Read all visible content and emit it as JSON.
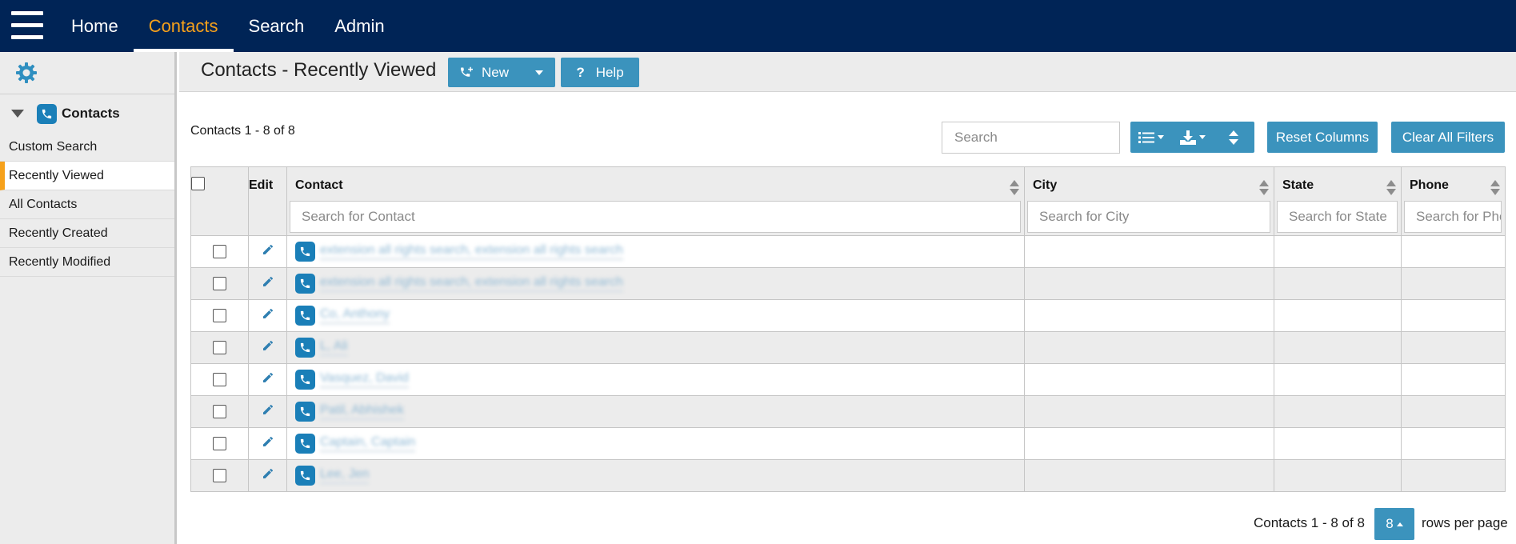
{
  "topnav": {
    "items": [
      {
        "label": "Home",
        "active": false
      },
      {
        "label": "Contacts",
        "active": true
      },
      {
        "label": "Search",
        "active": false
      },
      {
        "label": "Admin",
        "active": false
      }
    ]
  },
  "sidebar": {
    "heading": "Contacts",
    "items": [
      {
        "label": "Custom Search",
        "active": false
      },
      {
        "label": "Recently Viewed",
        "active": true
      },
      {
        "label": "All Contacts",
        "active": false
      },
      {
        "label": "Recently Created",
        "active": false
      },
      {
        "label": "Recently Modified",
        "active": false
      }
    ]
  },
  "page": {
    "title": "Contacts - Recently Viewed",
    "new_label": "New",
    "help_label": "Help",
    "count_top": "Contacts 1 - 8 of 8",
    "search_placeholder": "Search",
    "reset_label": "Reset Columns",
    "clear_label": "Clear All Filters",
    "count_bottom": "Contacts 1 - 8 of 8",
    "rows_per_page_value": "8",
    "rows_per_page_label": "rows per page"
  },
  "grid": {
    "columns": {
      "edit": "Edit",
      "contact": "Contact",
      "city": "City",
      "state": "State",
      "phone": "Phone"
    },
    "filters": {
      "contact": "Search for Contact",
      "city": "Search for City",
      "state": "Search for State",
      "phone": "Search for Phone"
    },
    "rows": [
      {
        "contact": "extension all rights search, extension all rights search",
        "city": "",
        "state": "",
        "phone": ""
      },
      {
        "contact": "extension all rights search, extension all rights search",
        "city": "",
        "state": "",
        "phone": ""
      },
      {
        "contact": "Co, Anthony",
        "city": "",
        "state": "",
        "phone": ""
      },
      {
        "contact": "L, Ali",
        "city": "",
        "state": "",
        "phone": ""
      },
      {
        "contact": "Vasquez, David",
        "city": "",
        "state": "",
        "phone": ""
      },
      {
        "contact": "Patil, Abhishek",
        "city": "",
        "state": "",
        "phone": ""
      },
      {
        "contact": "Captain, Captain",
        "city": "",
        "state": "",
        "phone": ""
      },
      {
        "contact": "Lee, Jen",
        "city": "",
        "state": "",
        "phone": ""
      }
    ]
  },
  "colors": {
    "navbar": "#002456",
    "accent": "#f6a11b",
    "button": "#3b93bd",
    "contact_badge": "#1a7fb8",
    "edit_icon": "#2f7fb1"
  }
}
